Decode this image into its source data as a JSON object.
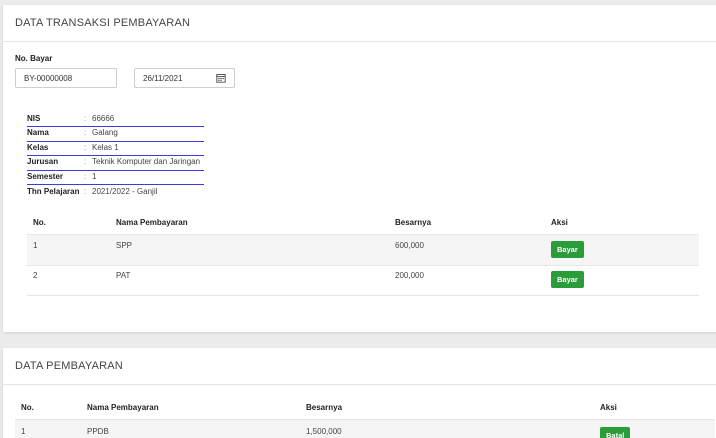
{
  "transaksi": {
    "title": "DATA TRANSAKSI PEMBAYARAN",
    "no_bayar_label": "No. Bayar",
    "no_bayar_value": "BY-00000008",
    "date_value": "26/11/2021",
    "info": [
      {
        "key": "NIS",
        "sep": ":",
        "value": "66666"
      },
      {
        "key": "Nama",
        "sep": ":",
        "value": "Galang"
      },
      {
        "key": "Kelas",
        "sep": ":",
        "value": "Kelas 1"
      },
      {
        "key": "Jurusan",
        "sep": ":",
        "value": "Teknik Komputer dan Jaringan"
      },
      {
        "key": "Semester",
        "sep": ":",
        "value": "1"
      },
      {
        "key": "Thn Pelajaran",
        "sep": ":",
        "value": "2021/2022 - Ganjil"
      }
    ],
    "table": {
      "headers": [
        "No.",
        "Nama Pembayaran",
        "Besarnya",
        "Aksi"
      ],
      "rows": [
        {
          "no": "1",
          "nama": "SPP",
          "besarnya": "600,000",
          "aksi": "Bayar"
        },
        {
          "no": "2",
          "nama": "PAT",
          "besarnya": "200,000",
          "aksi": "Bayar"
        }
      ]
    }
  },
  "pembayaran": {
    "title": "DATA PEMBAYARAN",
    "table": {
      "headers": [
        "No.",
        "Nama Pembayaran",
        "Besarnya",
        "Aksi"
      ],
      "rows": [
        {
          "no": "1",
          "nama": "PPDB",
          "besarnya": "1,500,000",
          "aksi": "Batal"
        }
      ]
    }
  },
  "colors": {
    "accent_line": "#3b3be0",
    "button_green": "#2a9d3a"
  },
  "icons": {
    "date": "calendar-icon"
  }
}
